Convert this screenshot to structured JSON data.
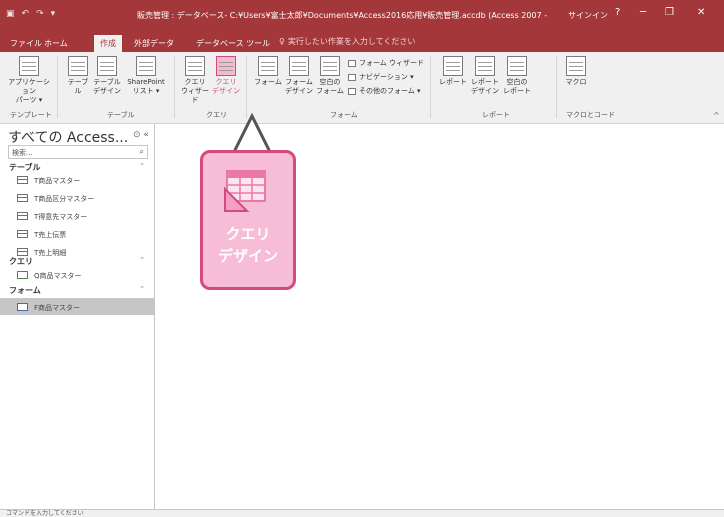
{
  "titlebar": {
    "title": "販売管理 : データベース- C:¥Users¥富士太郎¥Documents¥Access2016応用¥販売管理.accdb (Access 2007 - 2...",
    "signin": "サインイン",
    "help": "?",
    "minimize": "─",
    "restore": "❐",
    "close": "✕"
  },
  "tabs": [
    "ファイル",
    "ホーム",
    "作成",
    "外部データ",
    "データベース ツール"
  ],
  "active_tab": "作成",
  "tellme": "実行したい作業を入力してください",
  "ribbon": {
    "template_group": {
      "label": "テンプレート",
      "btn": "アプリケーション\nパーツ ▾"
    },
    "table_group": {
      "label": "テーブル",
      "btns": [
        "テーブル",
        "テーブル\nデザイン",
        "SharePoint\nリスト ▾"
      ]
    },
    "query_group": {
      "label": "クエリ",
      "btns": [
        "クエリ\nウィザード",
        "クエリ\nデザイン"
      ]
    },
    "form_group": {
      "label": "フォーム",
      "btns": [
        "フォーム",
        "フォーム\nデザイン",
        "空白の\nフォーム"
      ],
      "small": [
        "フォーム ウィザード",
        "ナビゲーション ▾",
        "その他のフォーム ▾"
      ]
    },
    "report_group": {
      "label": "レポート",
      "btns": [
        "レポート",
        "レポート\nデザイン",
        "空白の\nレポート"
      ]
    },
    "macro_group": {
      "label": "マクロとコード",
      "btns": [
        "マクロ"
      ]
    }
  },
  "nav": {
    "header": "すべての Access...",
    "search_placeholder": "検索...",
    "groups": [
      {
        "label": "テーブル",
        "items": [
          "T商品マスター",
          "T商品区分マスター",
          "T得意先マスター",
          "T売上伝票",
          "T売上明細"
        ]
      },
      {
        "label": "クエリ",
        "items": [
          "Q商品マスター"
        ]
      },
      {
        "label": "フォーム",
        "items": [
          "F商品マスター"
        ]
      }
    ],
    "selected_item": "F商品マスター"
  },
  "callout": {
    "line1": "クエリ",
    "line2": "デザイン"
  },
  "statusbar": "コマンドを入力してください",
  "colors": {
    "accent": "#a4373a",
    "highlight": "#d4497f",
    "highlight_fill": "#f7bcd6"
  }
}
